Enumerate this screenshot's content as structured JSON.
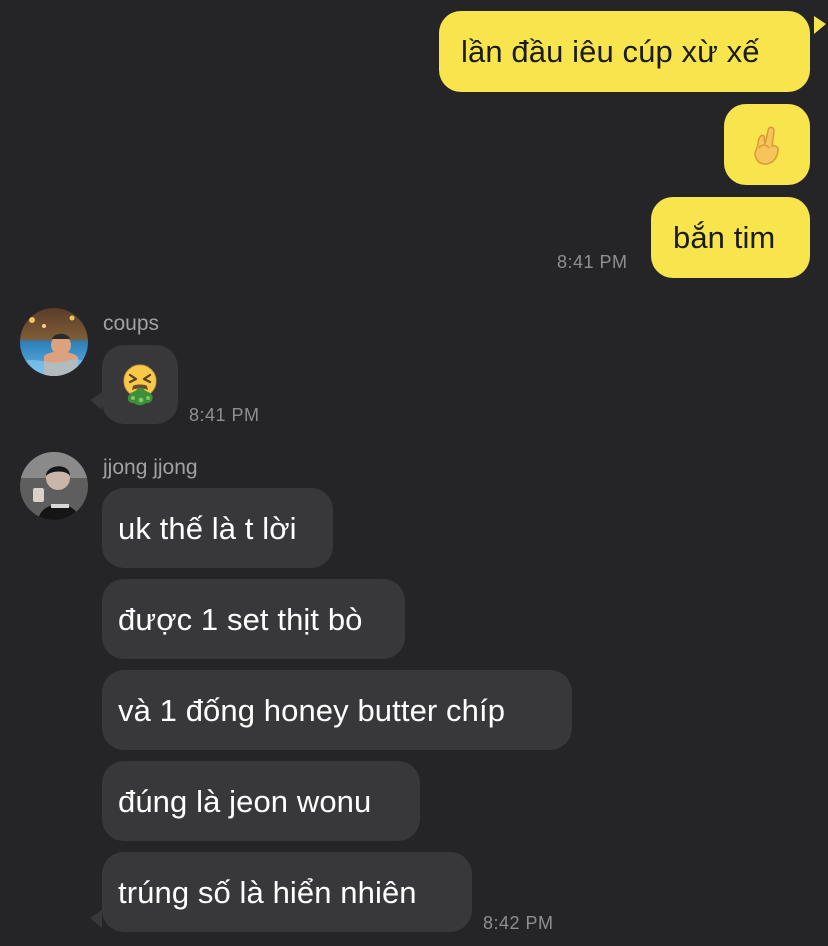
{
  "outgoing": {
    "messages": [
      "lần đầu iêu cúp xừ xế",
      "🫰",
      "bắn tim"
    ],
    "timestamp": "8:41 PM"
  },
  "incoming": [
    {
      "sender": "coups",
      "avatar_icon": "avatar-photo-pool",
      "messages": [
        "🤮"
      ],
      "timestamp": "8:41 PM"
    },
    {
      "sender": "jjong jjong",
      "avatar_icon": "avatar-photo-person",
      "messages": [
        "uk thế là t lời",
        "được 1 set thịt bò",
        "và 1 đống honey butter chíp",
        "đúng là jeon wonu",
        "trúng số là hiển nhiên"
      ],
      "timestamp": "8:42 PM"
    }
  ],
  "colors": {
    "background": "#252527",
    "outgoing_bubble": "#f8e44d",
    "incoming_bubble": "#38383a",
    "timestamp_text": "#8e8e93",
    "sender_name": "#a0a0a5"
  }
}
